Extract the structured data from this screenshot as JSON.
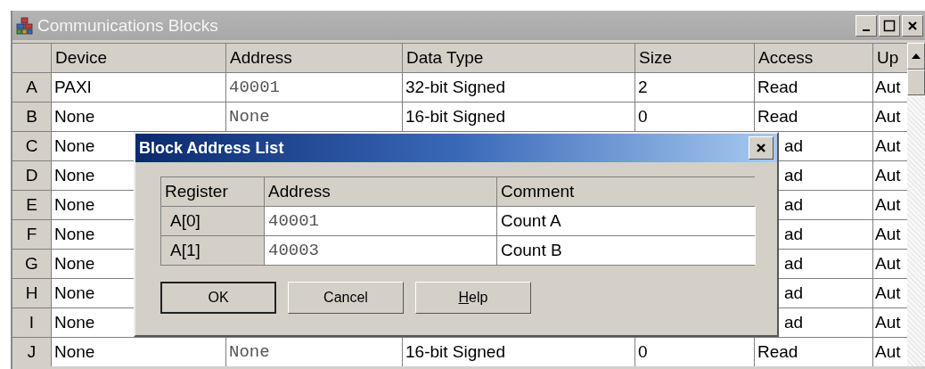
{
  "window": {
    "title": "Communications Blocks"
  },
  "table": {
    "columns": [
      "Device",
      "Address",
      "Data Type",
      "Size",
      "Access",
      "Up"
    ],
    "rows": [
      {
        "label": "A",
        "device": "PAXI",
        "address": "40001",
        "data_type": "32-bit Signed",
        "size": "2",
        "access": "Read",
        "update": "Aut"
      },
      {
        "label": "B",
        "device": "None",
        "address": "None",
        "data_type": "16-bit Signed",
        "size": "0",
        "access": "Read",
        "update": "Aut"
      },
      {
        "label": "C",
        "device": "None",
        "access": "ad",
        "update": "Aut"
      },
      {
        "label": "D",
        "device": "None",
        "access": "ad",
        "update": "Aut"
      },
      {
        "label": "E",
        "device": "None",
        "access": "ad",
        "update": "Aut"
      },
      {
        "label": "F",
        "device": "None",
        "access": "ad",
        "update": "Aut"
      },
      {
        "label": "G",
        "device": "None",
        "access": "ad",
        "update": "Aut"
      },
      {
        "label": "H",
        "device": "None",
        "access": "ad",
        "update": "Aut"
      },
      {
        "label": "I",
        "device": "None",
        "access": "ad",
        "update": "Aut"
      },
      {
        "label": "J",
        "device": "None",
        "address": "None",
        "data_type": "16-bit Signed",
        "size": "0",
        "access": "Read",
        "update": "Aut"
      }
    ]
  },
  "dialog": {
    "title": "Block Address List",
    "columns": [
      "Register",
      "Address",
      "Comment"
    ],
    "rows": [
      {
        "register": "A[0]",
        "address": "40001",
        "comment": "Count A"
      },
      {
        "register": "A[1]",
        "address": "40003",
        "comment": "Count B"
      }
    ],
    "buttons": [
      "OK",
      "Cancel",
      "Help"
    ]
  }
}
